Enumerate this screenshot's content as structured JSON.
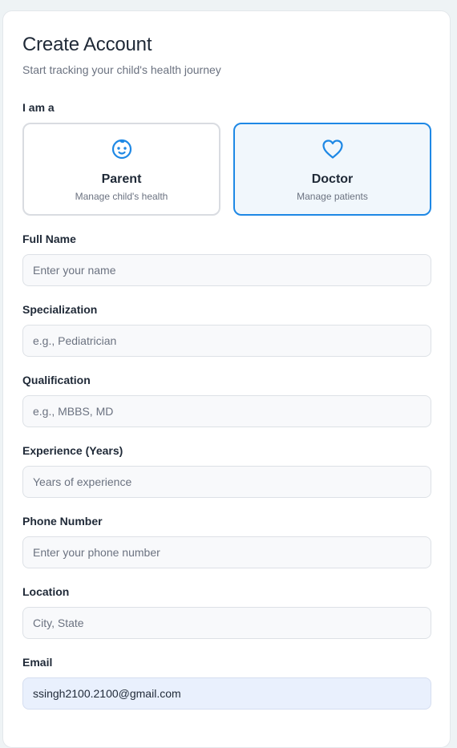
{
  "header": {
    "title": "Create Account",
    "subtitle": "Start tracking your child's health journey"
  },
  "role": {
    "label": "I am a",
    "selected": "Doctor",
    "options": [
      {
        "name": "Parent",
        "description": "Manage child's health",
        "icon": "baby-face-icon"
      },
      {
        "name": "Doctor",
        "description": "Manage patients",
        "icon": "heart-icon"
      }
    ]
  },
  "colors": {
    "accent": "#1e88e5",
    "muted_text": "#6b7280",
    "field_bg": "#f8f9fb"
  },
  "fields": {
    "full_name": {
      "label": "Full Name",
      "placeholder": "Enter your name",
      "value": ""
    },
    "specialization": {
      "label": "Specialization",
      "placeholder": "e.g., Pediatrician",
      "value": ""
    },
    "qualification": {
      "label": "Qualification",
      "placeholder": "e.g., MBBS, MD",
      "value": ""
    },
    "experience": {
      "label": "Experience (Years)",
      "placeholder": "Years of experience",
      "value": ""
    },
    "phone": {
      "label": "Phone Number",
      "placeholder": "Enter your phone number",
      "value": ""
    },
    "location": {
      "label": "Location",
      "placeholder": "City, State",
      "value": ""
    },
    "email": {
      "label": "Email",
      "placeholder": "",
      "value": "ssingh2100.2100@gmail.com"
    }
  }
}
